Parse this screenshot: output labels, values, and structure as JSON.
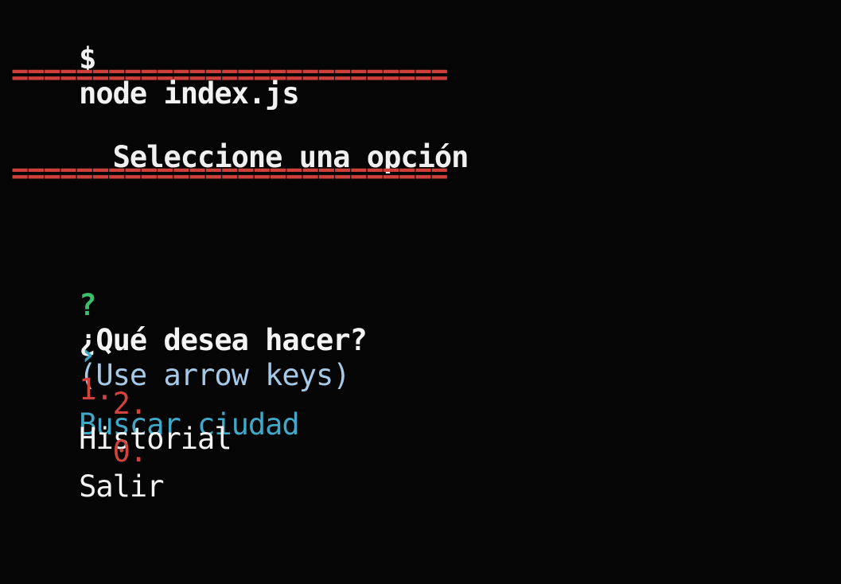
{
  "terminal": {
    "prompt_symbol": "$",
    "command": "node index.js",
    "separator_text": "===========================",
    "header_title": "  Seleccione una opción",
    "question_mark": "?",
    "question": "¿Qué desea hacer?",
    "hint": "(Use arrow keys)",
    "pointer": "›",
    "options": [
      {
        "number": "1.",
        "label": "Buscar ciudad",
        "selected": true
      },
      {
        "number": "2.",
        "label": "Historial",
        "selected": false
      },
      {
        "number": "0.",
        "label": "Salir",
        "selected": false
      }
    ],
    "colors": {
      "background": "#050505",
      "foreground": "#e6e6e6",
      "separator_red": "#cf3f3a",
      "separator_blue": "#4c8fd6",
      "question_mark": "#3bbf6a",
      "selected": "#40a8c8",
      "option_number": "#d2433d"
    }
  }
}
